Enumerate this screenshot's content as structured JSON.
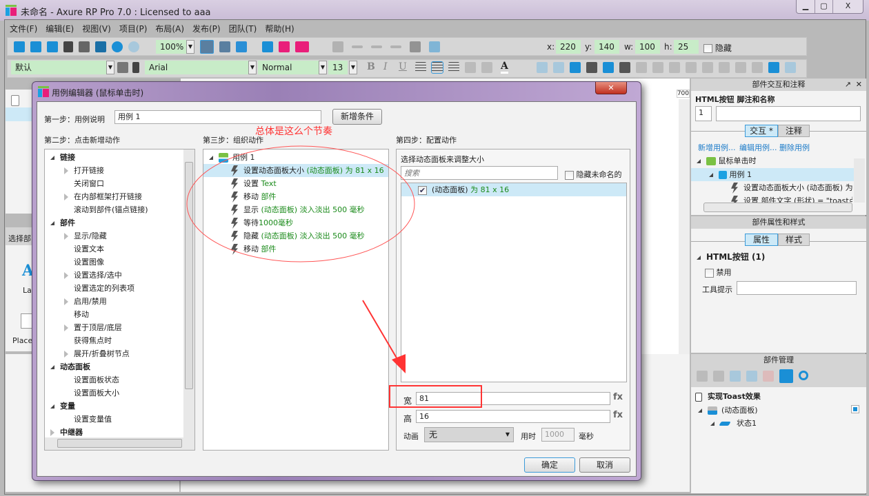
{
  "window": {
    "title": "未命名 - Axure RP Pro 7.0 : Licensed to aaa",
    "minimize": "▁",
    "maximize": "▢",
    "close": "X"
  },
  "menu": [
    "文件(F)",
    "编辑(E)",
    "视图(V)",
    "项目(P)",
    "布局(A)",
    "发布(P)",
    "团队(T)",
    "帮助(H)"
  ],
  "toolbar": {
    "zoom": "100%",
    "style": "默认",
    "font": "Arial",
    "weight": "Normal",
    "size": "13",
    "x_label": "x:",
    "x": "220",
    "y_label": "y:",
    "y": "140",
    "w_label": "w:",
    "w": "100",
    "h_label": "h:",
    "h": "25",
    "hidden_label": "隐藏",
    "bold": "B",
    "italic": "I",
    "underline": "U",
    "font_color": "A"
  },
  "left_panel": {
    "section2_title": "选择部",
    "widget1": "La",
    "widget2": "Place"
  },
  "canvas": {
    "ruler_mark": "700"
  },
  "dialog": {
    "title": "用例编辑器 (鼠标单击时)",
    "step1_label": "第一步：用例说明",
    "case_name": "用例 1",
    "add_condition": "新增条件",
    "step2_label": "第二步：点击新增动作",
    "step3_label": "第三步：组织动作",
    "step4_label": "第四步：配置动作",
    "actions_tree": [
      {
        "label": "链接",
        "level": 0,
        "expanded": true
      },
      {
        "label": "打开链接",
        "level": 1,
        "expandable": true
      },
      {
        "label": "关闭窗口",
        "level": 1
      },
      {
        "label": "在内部框架打开链接",
        "level": 1,
        "expandable": true
      },
      {
        "label": "滚动到部件(锚点链接)",
        "level": 1
      },
      {
        "label": "部件",
        "level": 0,
        "expanded": true
      },
      {
        "label": "显示/隐藏",
        "level": 1,
        "expandable": true
      },
      {
        "label": "设置文本",
        "level": 1
      },
      {
        "label": "设置图像",
        "level": 1
      },
      {
        "label": "设置选择/选中",
        "level": 1,
        "expandable": true
      },
      {
        "label": "设置选定的列表项",
        "level": 1
      },
      {
        "label": "启用/禁用",
        "level": 1,
        "expandable": true
      },
      {
        "label": "移动",
        "level": 1
      },
      {
        "label": "置于顶层/底层",
        "level": 1,
        "expandable": true
      },
      {
        "label": "获得焦点时",
        "level": 1
      },
      {
        "label": "展开/折叠树节点",
        "level": 1,
        "expandable": true
      },
      {
        "label": "动态面板",
        "level": 0,
        "expanded": true
      },
      {
        "label": "设置面板状态",
        "level": 1
      },
      {
        "label": "设置面板大小",
        "level": 1
      },
      {
        "label": "变量",
        "level": 0,
        "expanded": true
      },
      {
        "label": "设置变量值",
        "level": 1
      },
      {
        "label": "中继器",
        "level": 0,
        "expanded": false
      }
    ],
    "case_root": "用例 1",
    "organized_actions": [
      {
        "verb": "设置动态面板大小",
        "detail": " (动态面板) 为 81 x 16",
        "selected": true
      },
      {
        "verb": "设置",
        "detail": " Text"
      },
      {
        "verb": "移动",
        "detail": " 部件"
      },
      {
        "verb": "显示",
        "detail": " (动态面板) 淡入淡出 500 毫秒"
      },
      {
        "verb": "等待",
        "detail": "1000毫秒"
      },
      {
        "verb": "隐藏",
        "detail": " (动态面板) 淡入淡出 500 毫秒"
      },
      {
        "verb": "移动",
        "detail": " 部件"
      }
    ],
    "annotation": "总体是这么个节奏",
    "config": {
      "title": "选择动态面板来调整大小",
      "search_placeholder": "搜索",
      "hide_unnamed": "隐藏未命名的",
      "panel_item": "(动态面板)",
      "panel_item_detail": " 为 81 x 16",
      "width_label": "宽",
      "width": "81",
      "height_label": "高",
      "height": "16",
      "fx": "fx",
      "anim_label": "动画",
      "anim": "无",
      "duration_label": "用时",
      "duration": "1000",
      "ms": "毫秒"
    },
    "ok": "确定",
    "cancel": "取消"
  },
  "interaction_panel": {
    "title": "部件交互和注释",
    "widget_title": "HTML按钮 脚注和名称",
    "footnote": "1",
    "tabs": [
      "交互 *",
      "注释"
    ],
    "links": [
      "新增用例...",
      "编辑用例...",
      "删除用例"
    ],
    "event": "鼠标单击时",
    "case": "用例 1",
    "actions": [
      "设置动态面板大小 (动态面板) 为",
      "设置 部件文字 (形状) = \"toast点"
    ]
  },
  "props_panel": {
    "title": "部件属性和样式",
    "tabs": [
      "属性",
      "样式"
    ],
    "section": "HTML按钮 (1)",
    "disabled": "禁用",
    "tooltip": "工具提示"
  },
  "widget_manager": {
    "title": "部件管理",
    "page": "实现Toast效果",
    "panel": "(动态面板)",
    "state": "状态1"
  },
  "colors": {
    "accent": "#3a9ad9",
    "green_text": "#1a8a1a",
    "annotation": "#ff3333",
    "dialog_title": "#9a80b6"
  }
}
